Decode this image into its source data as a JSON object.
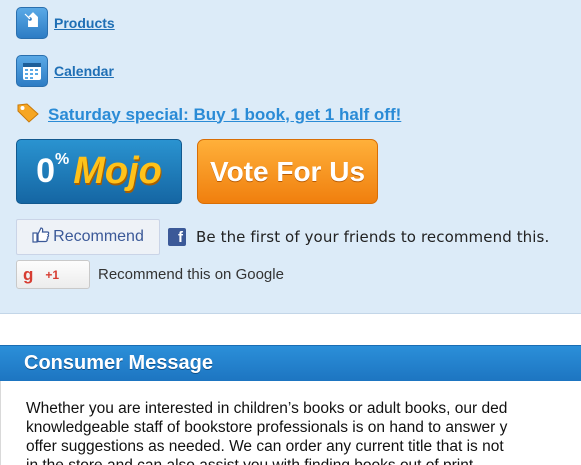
{
  "nav": {
    "products": {
      "label": "Products",
      "icon": "price-tag-icon"
    },
    "calendar": {
      "label": "Calendar",
      "icon": "calendar-icon"
    }
  },
  "special": {
    "label": "Saturday special: Buy 1 book, get 1 half off!",
    "icon": "orange-tag-icon"
  },
  "mojo": {
    "zero": "0",
    "percent": "%",
    "word": "Mojo"
  },
  "vote": {
    "label": "Vote For Us"
  },
  "facebook": {
    "recommend_label": "Recommend",
    "logo_letter": "f",
    "text": "Be the first of your friends to recommend this."
  },
  "google": {
    "g_letter": "g",
    "plus_label": "+1",
    "text": "Recommend this on Google"
  },
  "consumer": {
    "title": "Consumer Message",
    "lines": [
      "Whether you are interested in children’s books or adult books, our ded",
      "knowledgeable staff of bookstore professionals is on hand to answer y",
      "offer suggestions as needed. We can order any current title that is not",
      "in the store and can also assist you with finding books out of print."
    ]
  },
  "colors": {
    "panel_bg": "#dcebf8",
    "link": "#1f6fb5",
    "header_bg": "#1d75c1",
    "vote_orange": "#f07f0e",
    "mojo_yellow": "#ffc21a",
    "facebook_blue": "#3b5998",
    "google_red": "#d73d32"
  }
}
